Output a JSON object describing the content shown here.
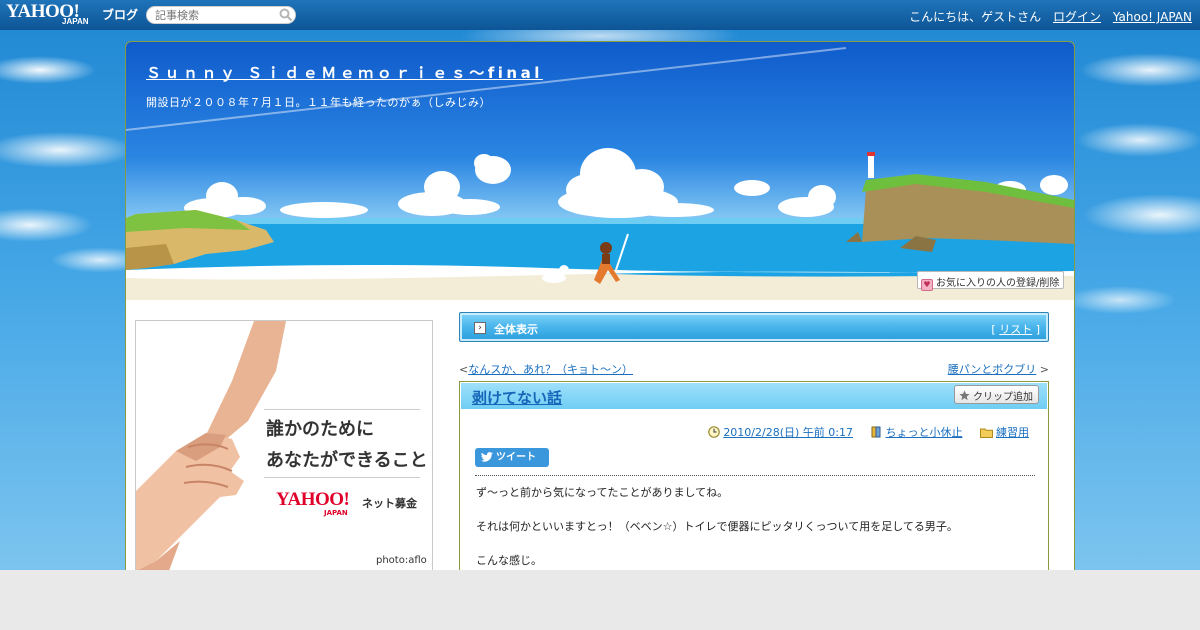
{
  "topbar": {
    "logo": "YAHOO!",
    "logo_sub": "JAPAN",
    "logo_service": "ブログ",
    "search_placeholder": "記事検索",
    "greeting": "こんにちは、ゲストさん",
    "login": "ログイン",
    "yahoo_japan": "Yahoo! JAPAN"
  },
  "blog": {
    "title": "Ｓｕｎｎｙ ＳｉｄｅＭｅｍｏｒｉｅｓ～final",
    "description": "開設日が２００８年７月１日。１１年も経ったのかぁ（しみじみ）",
    "fav_button": "お気に入りの人の登録/削除"
  },
  "ad": {
    "line1": "誰かのために",
    "line2": "あなたができること",
    "logo": "YAHOO!",
    "logo_sub": "JAPAN",
    "service": "ネット募金",
    "credit": "photo:aflo"
  },
  "nav": {
    "all_view": "全体表示",
    "list_link": "リスト",
    "prev": "なんスか、あれ？（キョト～ン）",
    "next": "腰パンとボクブリ"
  },
  "article": {
    "title": "剥けてない話",
    "clip_button": "クリップ追加",
    "date": "2010/2/28(日) 午前 0:17",
    "category": "ちょっと小休止",
    "folder": "練習用",
    "tweet": "ツイート",
    "paragraphs": [
      "ず～っと前から気になってたことがありましてね。",
      "それは何かといいますとっ！（ベベン☆）トイレで便器にピッタリくっついて用を足してる男子。",
      "こんな感じ。"
    ]
  },
  "colors": {
    "topbar": "#0d5596",
    "link": "#1a6fbf",
    "frame_border": "#8a9a3e",
    "bar": "#48b5ec"
  }
}
